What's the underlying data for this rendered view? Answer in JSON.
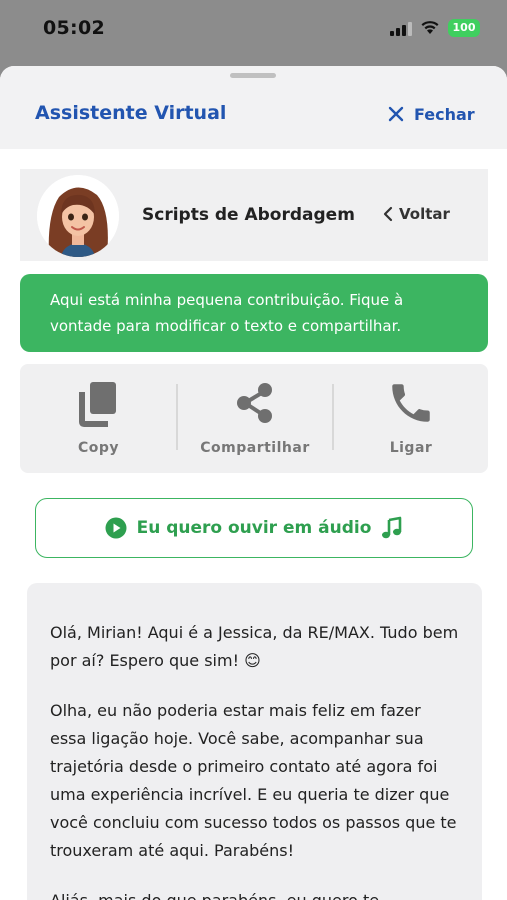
{
  "status_bar": {
    "time": "05:02",
    "battery": "100"
  },
  "header": {
    "title": "Assistente Virtual",
    "close_label": "Fechar"
  },
  "profile": {
    "title": "Scripts de Abordagem",
    "back_label": "Voltar"
  },
  "banner": {
    "text": "Aqui está minha pequena contribuição. Fique à vontade para modificar o texto e compartilhar."
  },
  "actions": [
    {
      "label": "Copy",
      "icon": "copy-icon"
    },
    {
      "label": "Compartilhar",
      "icon": "share-icon"
    },
    {
      "label": "Ligar",
      "icon": "phone-icon"
    }
  ],
  "audio_button": {
    "label": "Eu quero ouvir em áudio"
  },
  "message": {
    "paragraphs": [
      "Olá, Mirian! Aqui é a Jessica, da RE/MAX. Tudo bem por aí? Espero que sim! 😊",
      "Olha, eu não poderia estar mais feliz em fazer essa ligação hoje. Você sabe, acompanhar sua trajetória desde o primeiro contato até agora foi uma experiência incrível. E eu queria te dizer que você concluiu com sucesso todos os passos que te trouxeram até aqui. Parabéns!",
      "Aliás, mais do que parabéns, eu quero te"
    ]
  },
  "colors": {
    "accent_blue": "#2255b0",
    "green": "#3cb561",
    "sheet_bg": "#ffffff",
    "overlay": "#8c8c8c"
  }
}
